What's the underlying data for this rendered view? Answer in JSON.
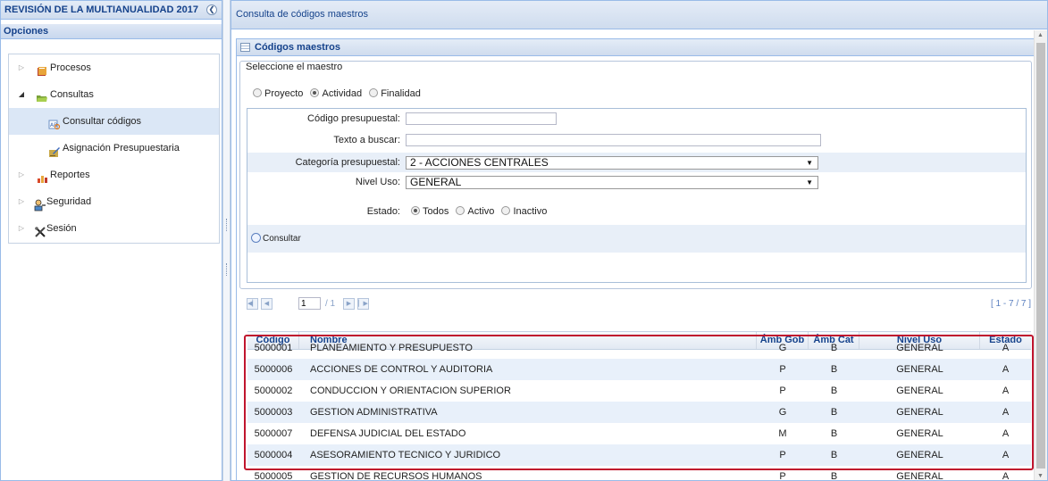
{
  "left_panel": {
    "title": "REVISIÓN DE LA MULTIANUALIDAD 2017",
    "options_label": "Opciones",
    "tree": [
      {
        "label": "Procesos",
        "icon": "book-icon"
      },
      {
        "label": "Consultas",
        "icon": "folder-open-icon"
      },
      {
        "label": "Consultar códigos",
        "icon": "search-code-icon"
      },
      {
        "label": "Asignación Presupuestaria",
        "icon": "pencil-edit-icon"
      },
      {
        "label": "Reportes",
        "icon": "chart-report-icon"
      },
      {
        "label": "Seguridad",
        "icon": "users-key-icon"
      },
      {
        "label": "Sesión",
        "icon": "tools-icon"
      }
    ]
  },
  "main": {
    "title": "Consulta de códigos maestros",
    "panel_title": "Códigos maestros",
    "fieldset_legend": "Seleccione el maestro",
    "maestro_options": [
      "Proyecto",
      "Actividad",
      "Finalidad"
    ],
    "maestro_selected": "Actividad",
    "form": {
      "codigo_label": "Código presupuestal:",
      "codigo_value": "",
      "texto_label": "Texto a buscar:",
      "texto_value": "",
      "categoria_label": "Categoría presupuestal:",
      "categoria_value": "2 - ACCIONES CENTRALES",
      "nivel_label": "Nivel Uso:",
      "nivel_value": "GENERAL",
      "estado_label": "Estado:",
      "estado_options": [
        "Todos",
        "Activo",
        "Inactivo"
      ],
      "estado_selected": "Todos",
      "consultar_label": "Consultar"
    },
    "pager": {
      "page": "1",
      "total": "/ 1",
      "info": "[ 1 - 7 / 7 ]"
    },
    "grid": {
      "columns": [
        "Código",
        "Nombre",
        "Ámb Gob",
        "Ámb Cat",
        "Nivel Uso",
        "Estado"
      ],
      "rows": [
        [
          "5000001",
          "PLANEAMIENTO Y PRESUPUESTO",
          "G",
          "B",
          "GENERAL",
          "A"
        ],
        [
          "5000006",
          "ACCIONES DE CONTROL Y AUDITORIA",
          "P",
          "B",
          "GENERAL",
          "A"
        ],
        [
          "5000002",
          "CONDUCCION Y ORIENTACION SUPERIOR",
          "P",
          "B",
          "GENERAL",
          "A"
        ],
        [
          "5000003",
          "GESTION ADMINISTRATIVA",
          "G",
          "B",
          "GENERAL",
          "A"
        ],
        [
          "5000007",
          "DEFENSA JUDICIAL DEL ESTADO",
          "M",
          "B",
          "GENERAL",
          "A"
        ],
        [
          "5000004",
          "ASESORAMIENTO TECNICO Y JURIDICO",
          "P",
          "B",
          "GENERAL",
          "A"
        ],
        [
          "5000005",
          "GESTION DE RECURSOS HUMANOS",
          "P",
          "B",
          "GENERAL",
          "A"
        ]
      ]
    }
  },
  "colors": {
    "header_text": "#15428b",
    "highlight_border": "#c0152e",
    "alt_row": "#e8f0fa"
  }
}
